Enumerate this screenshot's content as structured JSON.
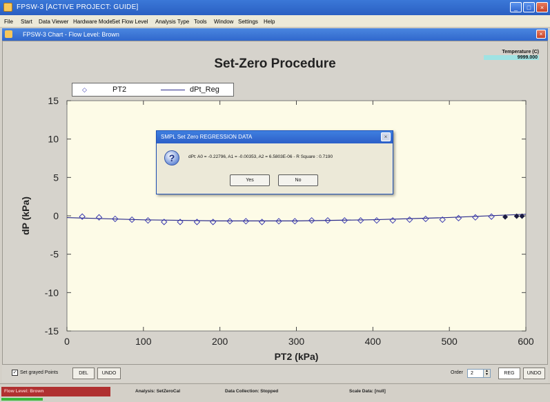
{
  "window": {
    "title": "FPSW-3 [ACTIVE PROJECT: GUIDE]"
  },
  "menu": [
    "File",
    "Start",
    "Data Viewer",
    "Hardware Mode",
    "Set Flow Level",
    "Analysis Type",
    "Tools",
    "Window",
    "Settings",
    "Help"
  ],
  "child_window": {
    "title": "FPSW-3 Chart - Flow Level: Brown"
  },
  "temperature": {
    "label": "Temperature (C)",
    "value": "9999.000"
  },
  "legend": {
    "marker_symbol": "◇",
    "pt2": "PT2",
    "dpt_reg": "dPt_Reg"
  },
  "dialog": {
    "title": "SMPL Set Zero REGRESSION DATA",
    "icon": "question-icon",
    "message": "dPt: A0 = -0.22796, A1 = -0.00353, A2 = 6.5803E-06 - R Square : 0.7190",
    "yes_label": "Yes",
    "no_label": "No"
  },
  "controls": {
    "checkbox_label": "Set grayed Points",
    "checkbox_checked": true,
    "del_label": "DEL",
    "undo_left_label": "UNDO",
    "order_label": "Order",
    "order_value": "2",
    "reg_label": "REG",
    "undo_right_label": "UNDO"
  },
  "status": {
    "left": "Flow Level: Brown",
    "analysis": "Analysis: SetZeroCal",
    "collection": "Data Collection: Stopped",
    "scale": "Scale Data: [null]"
  },
  "chart_data": {
    "type": "scatter",
    "title": "Set-Zero Procedure",
    "xlabel": "PT2 (kPa)",
    "ylabel": "dP (kPa)",
    "xlim": [
      0,
      600
    ],
    "ylim": [
      -15,
      15
    ],
    "x_ticks": [
      0,
      100,
      200,
      300,
      400,
      500,
      600
    ],
    "y_ticks": [
      15,
      10,
      5,
      0,
      -5,
      -10,
      -15
    ],
    "grid": false,
    "legend_position": "top-left",
    "colors": {
      "plot_bg": "#fdfbe7",
      "marker": "#3a3ab0",
      "line": "#2a2a8a",
      "dark_marker": "#1a1a40"
    },
    "series": [
      {
        "name": "PT2",
        "marker": "diamond-open",
        "x": [
          20,
          42,
          63,
          85,
          106,
          127,
          148,
          170,
          191,
          213,
          234,
          255,
          277,
          298,
          320,
          341,
          363,
          384,
          405,
          426,
          448,
          469,
          491,
          512,
          534,
          555
        ],
        "y": [
          -0.1,
          -0.2,
          -0.4,
          -0.5,
          -0.6,
          -0.8,
          -0.8,
          -0.8,
          -0.8,
          -0.7,
          -0.7,
          -0.8,
          -0.7,
          -0.7,
          -0.6,
          -0.6,
          -0.6,
          -0.6,
          -0.6,
          -0.6,
          -0.5,
          -0.4,
          -0.5,
          -0.3,
          -0.2,
          -0.1
        ]
      },
      {
        "name": "dPt_Reg",
        "style": "line",
        "x": [
          0,
          100,
          200,
          300,
          400,
          500,
          600
        ],
        "y": [
          -0.23,
          -0.52,
          -0.66,
          -0.66,
          -0.51,
          -0.22,
          0.21
        ]
      },
      {
        "name": "dark",
        "marker": "diamond-filled",
        "x": [
          573,
          588,
          595
        ],
        "y": [
          -0.15,
          -0.05,
          -0.05
        ]
      }
    ]
  }
}
